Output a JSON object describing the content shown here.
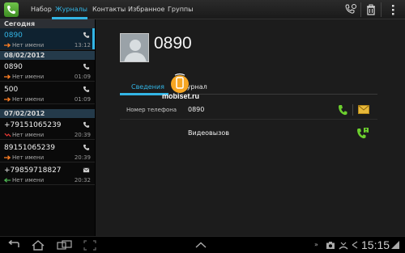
{
  "topbar": {
    "tabs": [
      "Набор",
      "Журналы",
      "Контакты",
      "Избранное",
      "Группы"
    ],
    "active_tab": "Журналы"
  },
  "calllog": {
    "sections": [
      {
        "title": "Сегодня",
        "entries": [
          {
            "number": "0890",
            "name": "Нет имени",
            "time": "13:12",
            "type": "outgoing",
            "method": "call-icon",
            "selected": true
          }
        ]
      },
      {
        "title": "08/02/2012",
        "entries": [
          {
            "number": "0890",
            "name": "Нет имени",
            "time": "01:09",
            "type": "outgoing",
            "method": "call-icon"
          },
          {
            "number": "500",
            "name": "Нет имени",
            "time": "01:09",
            "type": "outgoing",
            "method": "call-icon"
          }
        ]
      },
      {
        "title": "07/02/2012",
        "entries": [
          {
            "number": "+79151065239",
            "name": "Нет имени",
            "time": "20:39",
            "type": "missed",
            "method": "call-icon"
          },
          {
            "number": "89151065239",
            "name": "Нет имени",
            "time": "20:39",
            "type": "outgoing",
            "method": "call-icon"
          },
          {
            "number": "+79859718827",
            "name": "Нет имени",
            "time": "20:32",
            "type": "incoming",
            "method": "message-icon"
          }
        ]
      }
    ]
  },
  "detail": {
    "name": "0890",
    "tabs": [
      "Сведения",
      "Журнал"
    ],
    "phone_label": "Номер телефона",
    "phone_value": "0890",
    "video_call_label": "Видеовызов"
  },
  "watermark": "mobiset.ru",
  "statusbar": {
    "time": "15:15"
  },
  "colors": {
    "accent": "#33b5e5",
    "outgoing": "#ff7f24",
    "missed": "#e53935",
    "incoming": "#4caf50",
    "call_green": "#6ccf2e"
  }
}
